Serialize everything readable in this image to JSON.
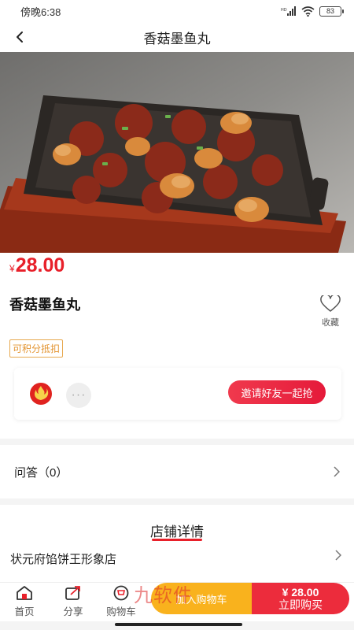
{
  "status_bar": {
    "time": "傍晚6:38",
    "signal_label": "HD",
    "battery": "83"
  },
  "nav": {
    "title": "香菇墨鱼丸"
  },
  "product": {
    "currency": "¥",
    "price": "28.00",
    "name": "香菇墨鱼丸",
    "favorite_label": "收藏",
    "points_tag": "可积分抵扣"
  },
  "group": {
    "invite_label": "邀请好友一起抢",
    "more_dots": "···"
  },
  "qa": {
    "label": "问答（0）"
  },
  "shop": {
    "heading": "店铺详情",
    "name": "状元府馅饼王形象店"
  },
  "tabs": [
    {
      "label": "首页",
      "icon": "home-icon"
    },
    {
      "label": "分享",
      "icon": "share-icon"
    },
    {
      "label": "购物车",
      "icon": "cart-icon"
    }
  ],
  "actions": {
    "add_to_cart": "加入购物车",
    "buy_price": "¥ 28.00",
    "buy_now": "立即购买"
  },
  "watermark": "九软件",
  "colors": {
    "accent_red": "#e8202a",
    "cart_yellow": "#f9b21d",
    "buy_red": "#ec2c3c",
    "points_orange": "#e39430"
  }
}
